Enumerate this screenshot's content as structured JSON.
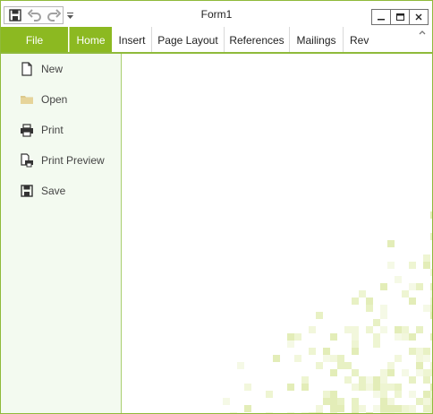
{
  "window": {
    "title": "Form1"
  },
  "quick_access": {
    "items": [
      {
        "name": "save-icon"
      },
      {
        "name": "undo-icon"
      },
      {
        "name": "redo-icon"
      }
    ],
    "dropdown": "customize-quick-access-icon"
  },
  "window_controls": {
    "minimize": "minimize-icon",
    "maximize": "maximize-icon",
    "close": "close-icon"
  },
  "ribbon": {
    "file_tab": "File",
    "tabs": [
      "Home",
      "Insert",
      "Page Layout",
      "References",
      "Mailings",
      "Rev"
    ],
    "active_tab": "Home",
    "accent": "#8cb921"
  },
  "backstage": {
    "items": [
      {
        "label": "New",
        "icon": "new-document-icon"
      },
      {
        "label": "Open",
        "icon": "folder-icon"
      },
      {
        "label": "Print",
        "icon": "printer-icon"
      },
      {
        "label": "Print Preview",
        "icon": "print-preview-icon"
      },
      {
        "label": "Save",
        "icon": "save-icon"
      }
    ]
  }
}
